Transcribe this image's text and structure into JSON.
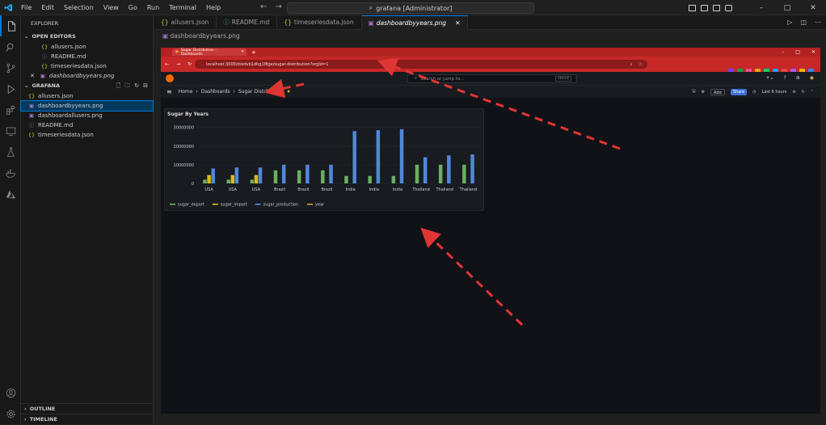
{
  "menu": {
    "items": [
      "File",
      "Edit",
      "Selection",
      "View",
      "Go",
      "Run",
      "Terminal",
      "Help"
    ]
  },
  "command_center": {
    "text": "grafana [Administrator]",
    "icon": "search-icon"
  },
  "window": {
    "minimize": "–",
    "maximize": "□",
    "close": "✕"
  },
  "activity_bar": {
    "items": [
      "explorer-icon",
      "search-icon",
      "source-control-icon",
      "run-debug-icon",
      "extensions-icon",
      "remote-explorer-icon",
      "testing-icon",
      "docker-icon",
      "azure-icon"
    ],
    "bottom": [
      "account-icon",
      "settings-gear-icon"
    ]
  },
  "sidebar": {
    "title": "EXPLORER",
    "open_editors_label": "OPEN EDITORS",
    "open_editors": [
      {
        "icon": "{}",
        "name": "allusers.json",
        "type": "json"
      },
      {
        "icon": "ⓘ",
        "name": "README.md",
        "type": "info"
      },
      {
        "icon": "{}",
        "name": "timeseriesdata.json",
        "type": "json"
      },
      {
        "icon": "▣",
        "name": "dashboardbyyears.png",
        "type": "img",
        "close": "✕"
      }
    ],
    "folder_label": "GRAFANA",
    "files": [
      {
        "icon": "{}",
        "name": "allusers.json",
        "type": "json"
      },
      {
        "icon": "▣",
        "name": "dashboardbyyears.png",
        "type": "img"
      },
      {
        "icon": "▣",
        "name": "dashboardallusers.png",
        "type": "img"
      },
      {
        "icon": "ⓘ",
        "name": "README.md",
        "type": "info"
      },
      {
        "icon": "{}",
        "name": "timeseriesdata.json",
        "type": "json"
      }
    ],
    "outline_label": "OUTLINE",
    "timeline_label": "TIMELINE"
  },
  "tabs": [
    {
      "icon": "{}",
      "label": "allusers.json",
      "type": "json"
    },
    {
      "icon": "ⓘ",
      "label": "README.md",
      "type": "info"
    },
    {
      "icon": "{}",
      "label": "timeseriesdata.json",
      "type": "json"
    },
    {
      "icon": "▣",
      "label": "dashboardbyyears.png",
      "type": "img",
      "close": "✕"
    }
  ],
  "breadcrumb": {
    "file": "dashboardbyyears.png"
  },
  "browser": {
    "tab_title": "Sugar Distribution - Dashboards",
    "url": "localhost:3000/d/edvb1dhg1f8ge/sugar-distribution?orgId=1",
    "ext_colors": [
      "#7c3aed",
      "#16a34a",
      "#ec4899",
      "#f59e0b",
      "#22c55e",
      "#0ea5e9",
      "#ef4444",
      "#a855f7",
      "#eab308",
      "#3b82f6"
    ]
  },
  "grafana": {
    "search_placeholder": "Search or jump to...",
    "shortcut": "ctrl+k",
    "breadcrumb": [
      "Home",
      "Dashboards",
      "Sugar Distribution"
    ],
    "add_label": "Add",
    "share_label": "Share",
    "time_range": "Last 6 hours",
    "panel_title": "Sugar By Years"
  },
  "chart_data": {
    "type": "bar",
    "title": "Sugar By Years",
    "categories": [
      "USA",
      "USA",
      "USA",
      "Brazil",
      "Brazil",
      "Brazil",
      "India",
      "India",
      "India",
      "Thailand",
      "Thailand",
      "Thailand"
    ],
    "ylim": [
      0,
      32000000
    ],
    "yticks": [
      0,
      10000000,
      20000000,
      30000000
    ],
    "ytick_labels": [
      "0",
      "10000000",
      "20000000",
      "30000000"
    ],
    "series": [
      {
        "name": "sugar_export",
        "color": "#73bf69",
        "values": [
          2000000,
          2000000,
          2000000,
          7000000,
          7000000,
          7000000,
          4000000,
          4000000,
          4000000,
          10000000,
          10000000,
          10000000
        ]
      },
      {
        "name": "sugar_import",
        "color": "#f2cc0c",
        "values": [
          4500000,
          4500000,
          4500000,
          0,
          0,
          0,
          0,
          0,
          0,
          0,
          0,
          0
        ]
      },
      {
        "name": "sugar_production",
        "color": "#5794f2",
        "values": [
          8000000,
          8500000,
          8500000,
          10000000,
          10000000,
          10000000,
          28000000,
          28500000,
          29000000,
          14000000,
          15000000,
          15500000
        ]
      },
      {
        "name": "year",
        "color": "#ff9830",
        "values": [
          2019,
          2020,
          2021,
          2019,
          2020,
          2021,
          2019,
          2020,
          2021,
          2019,
          2020,
          2021
        ]
      }
    ],
    "legend": "bottom-left"
  }
}
